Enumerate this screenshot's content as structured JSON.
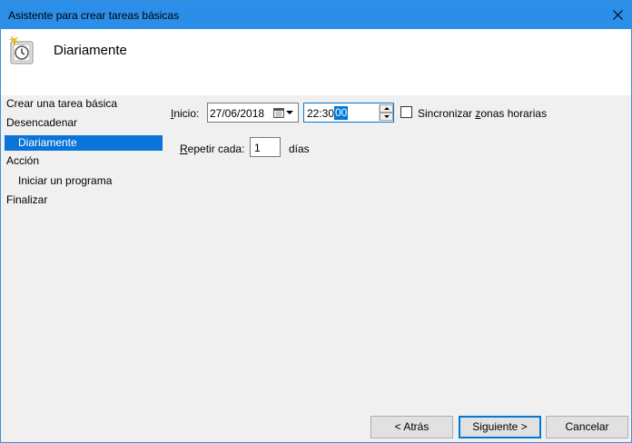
{
  "window": {
    "title": "Asistente para crear tareas básicas",
    "close_glyph": "✕"
  },
  "header": {
    "icon": "task-clock-icon",
    "title": "Diariamente"
  },
  "sidebar": {
    "items": [
      {
        "label": "Crear una tarea básica"
      },
      {
        "label": "Desencadenar"
      },
      {
        "label": "Diariamente"
      },
      {
        "label": "Acción"
      },
      {
        "label": "Iniciar un programa"
      },
      {
        "label": "Finalizar"
      }
    ]
  },
  "form": {
    "start_label_pre": "I",
    "start_label_post": "nicio:",
    "start_date": "27/06/2018",
    "start_time_pre": "22:30:",
    "start_time_sel": "00",
    "sync_label_pre": "Sincronizar ",
    "sync_label_u": "z",
    "sync_label_post": "onas horarias",
    "repeat_label_u": "R",
    "repeat_label_post": "epetir cada:",
    "repeat_value": "1",
    "repeat_unit": "días"
  },
  "footer": {
    "back_label": "< Atrás",
    "next_label": "Siguiente >",
    "cancel_label": "Cancelar"
  },
  "colors": {
    "titlebar": "#2b8ee8",
    "selection": "#0a74d8",
    "accent_border": "#0078d7"
  }
}
